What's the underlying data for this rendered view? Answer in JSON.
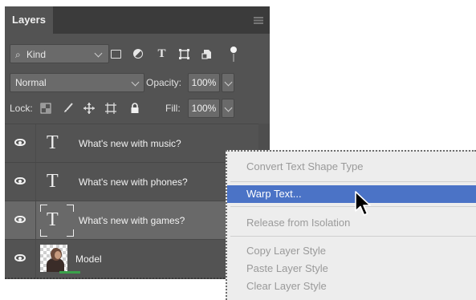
{
  "panel": {
    "tab_label": "Layers",
    "filter": {
      "kind_label": "Kind",
      "search_glyph": "⌕"
    },
    "blend_mode": "Normal",
    "opacity_label": "Opacity:",
    "opacity_value": "100%",
    "lock_label": "Lock:",
    "fill_label": "Fill:",
    "fill_value": "100%",
    "layers": [
      {
        "name": "What's new with music?",
        "type": "text",
        "visible": true,
        "selected": false
      },
      {
        "name": "What's new with phones?",
        "type": "text",
        "visible": true,
        "selected": false
      },
      {
        "name": "What's new with games?",
        "type": "text",
        "visible": true,
        "selected": true
      },
      {
        "name": "Model",
        "type": "image",
        "visible": true,
        "selected": false
      }
    ],
    "type_glyph": "T"
  },
  "context_menu": {
    "items": [
      {
        "label": "Convert Text Shape Type",
        "enabled": false,
        "highlighted": false
      },
      {
        "label": "Warp Text...",
        "enabled": true,
        "highlighted": true
      },
      {
        "label": "Release from Isolation",
        "enabled": false,
        "highlighted": false
      },
      {
        "label": "Copy Layer Style",
        "enabled": false,
        "highlighted": false
      },
      {
        "label": "Paste Layer Style",
        "enabled": false,
        "highlighted": false
      },
      {
        "label": "Clear Layer Style",
        "enabled": false,
        "highlighted": false
      }
    ]
  },
  "colors": {
    "panel_bg": "#535353",
    "selected_row": "#696969",
    "menu_bg": "#ededed",
    "menu_highlight": "#4b73c6"
  }
}
